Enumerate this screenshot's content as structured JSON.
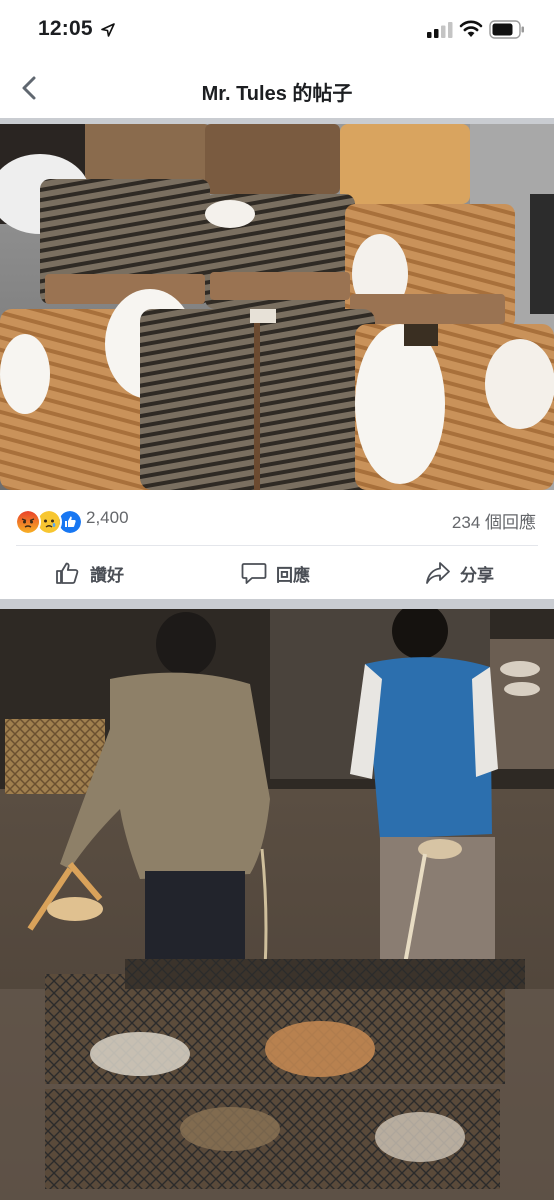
{
  "status_bar": {
    "time": "12:05",
    "icons": [
      "location-arrow-icon",
      "signal-icon",
      "wifi-icon",
      "battery-icon"
    ]
  },
  "nav": {
    "title": "Mr. Tules 的帖子",
    "back_icon": "chevron-left-icon"
  },
  "post1": {
    "image_alt": "",
    "reactions": {
      "icons": [
        "angry-emoji",
        "sad-emoji",
        "like-icon"
      ],
      "count": "2,400"
    },
    "comments_count": "234 個回應",
    "actions": {
      "like_label": "讚好",
      "comment_label": "回應",
      "share_label": "分享"
    }
  },
  "post2": {
    "image_alt": ""
  },
  "colors": {
    "divider": "#c9ccd1",
    "like_blue": "#1877f2",
    "angry_orange": "#f15b2a",
    "sad_yellow": "#f7b125",
    "text_gray": "#65676b"
  }
}
